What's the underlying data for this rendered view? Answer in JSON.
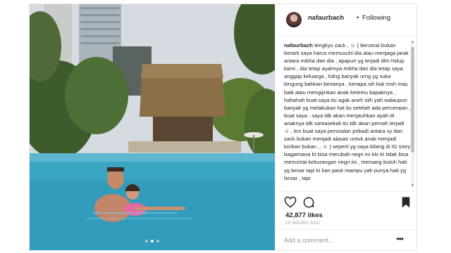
{
  "header": {
    "username": "nafaurbach",
    "separator": "•",
    "follow_label": "Following"
  },
  "caption": {
    "username": "nafaurbach",
    "text": "tengkyu zack , ☺ ( bercerai bukan berarti saya harus memusuhi dia atau menjaga jarak antara mikha dan dia , apapun yg terjadi dlm hidup kami , dia tetap ayahnya mikha dan dia tetap saya anggap keluarga , kdng banyak orng yg suka bingung bahkan bertanya , kenapa sih kok msh mau baik atau mengijinkan anak ketemu bapaknya , hahahah buat saya itu agak aneh siih yah walaupun banyak yg melakukan hal itu setelah ada perceraian , buat saya , saya tdk akan menjauhkan ayah dr anaknya tdk samasekali itu tdk akan pernah terjadi ☺ , krn buat saya persoalan pribadi antara sy dan zack bukan menjadi alasan untuk anak menjadi korban bukan ,, ☺ ) seperti yg saya bilang di IG story bagaimana kt bisa merubah negri ini klo kt tidak bisa mencintai kekurangan negri ini , memang butuh hati yg besar tapi kt kan pasti mampu yah punya hati yg besar , tapi"
  },
  "actions": {
    "like_icon": "heart-outline-icon",
    "comment_icon": "speech-bubble-icon",
    "save_icon": "bookmark-filled-icon"
  },
  "likes": "42,877 likes",
  "timestamp": "13 HOURS AGO",
  "comment_input": {
    "placeholder": "Add a comment...",
    "value": ""
  },
  "more_label": "•••",
  "carousel": {
    "dot_count": 3,
    "active_index": 1
  }
}
